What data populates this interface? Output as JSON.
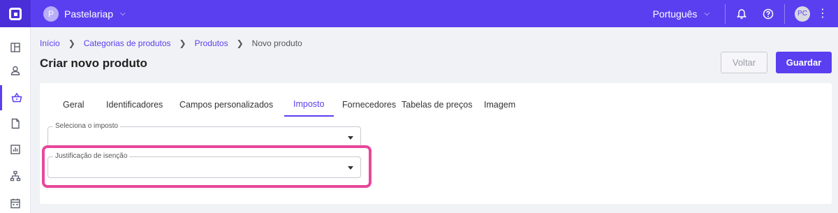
{
  "topbar": {
    "org_initial": "P",
    "org_name": "Pastelariap",
    "language": "Português",
    "avatar_initials": "PC"
  },
  "sidebar": {
    "items": [
      {
        "icon": "dashboard-icon"
      },
      {
        "icon": "user-icon"
      },
      {
        "icon": "basket-icon",
        "active": true
      },
      {
        "icon": "document-icon"
      },
      {
        "icon": "chart-icon"
      },
      {
        "icon": "network-icon"
      },
      {
        "icon": "calendar-icon"
      }
    ]
  },
  "breadcrumb": {
    "items": [
      "Início",
      "Categorias de produtos",
      "Produtos"
    ],
    "current": "Novo produto"
  },
  "page": {
    "title": "Criar novo produto",
    "back_label": "Voltar",
    "save_label": "Guardar"
  },
  "tabs": [
    "Geral",
    "Identificadores",
    "Campos personalizados",
    "Imposto",
    "Fornecedores",
    "Tabelas de preços",
    "Imagem"
  ],
  "active_tab": "Imposto",
  "form": {
    "tax_label": "Seleciona o imposto",
    "tax_value": "",
    "exemption_label": "Justificação de isenção",
    "exemption_value": ""
  },
  "colors": {
    "accent": "#5a3ff0",
    "highlight": "#e8479b"
  }
}
